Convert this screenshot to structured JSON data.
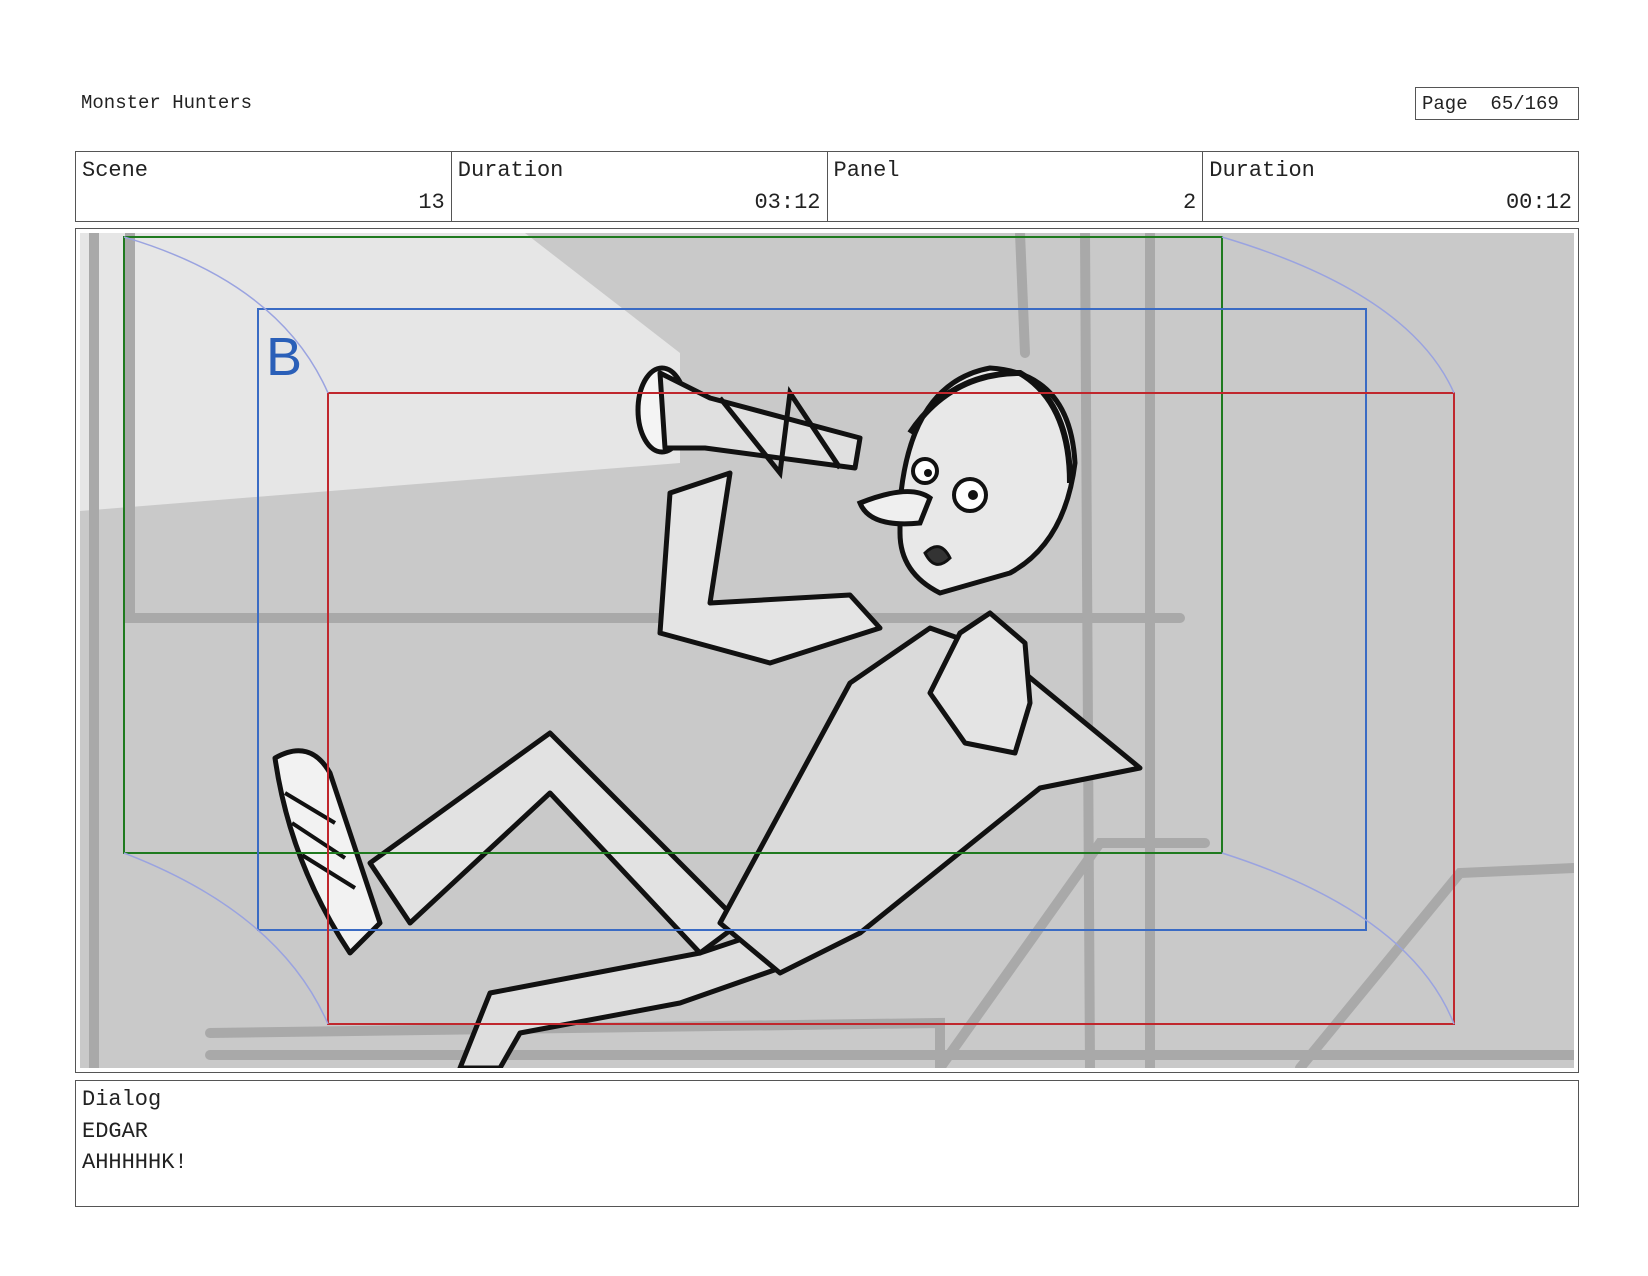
{
  "header": {
    "project_title": "Monster Hunters",
    "page_label": "Page",
    "page_number": "65/169"
  },
  "info": {
    "scene_label": "Scene",
    "scene_value": "13",
    "scene_duration_label": "Duration",
    "scene_duration_value": "03:12",
    "panel_label": "Panel",
    "panel_value": "2",
    "panel_duration_label": "Duration",
    "panel_duration_value": "00:12"
  },
  "panel": {
    "camera_marker": "B",
    "frame_colors": {
      "outer": "#1f7a1f",
      "mid": "#3a6bc4",
      "inner": "#c0272d"
    }
  },
  "dialog": {
    "label": "Dialog",
    "character": "EDGAR",
    "line": "AHHHHHK!"
  }
}
